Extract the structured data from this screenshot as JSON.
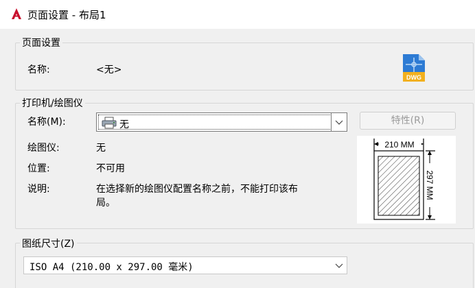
{
  "window": {
    "title": "页面设置 - 布局1"
  },
  "page_setup": {
    "group_title": "页面设置",
    "name_label": "名称:",
    "name_value": "<无>",
    "file_icon_text": "DWG"
  },
  "plotter": {
    "group_title": "打印机/绘图仪",
    "name_label": "名称(M):",
    "name_value": "无",
    "properties_button": "特性(R)",
    "plotter_label": "绘图仪:",
    "plotter_value": "无",
    "location_label": "位置:",
    "location_value": "不可用",
    "description_label": "说明:",
    "description_line1": "在选择新的绘图仪配置名称之前，不能打印该布",
    "description_line2": "局。",
    "preview_width": "210 MM",
    "preview_height": "297 MM"
  },
  "paper_size": {
    "group_title": "图纸尺寸(Z)",
    "value": "ISO A4 (210.00 x 297.00 毫米)"
  },
  "colors": {
    "app_red": "#c8102e",
    "group_border": "#d6d6d6",
    "disabled_text": "#9a9a9a"
  }
}
